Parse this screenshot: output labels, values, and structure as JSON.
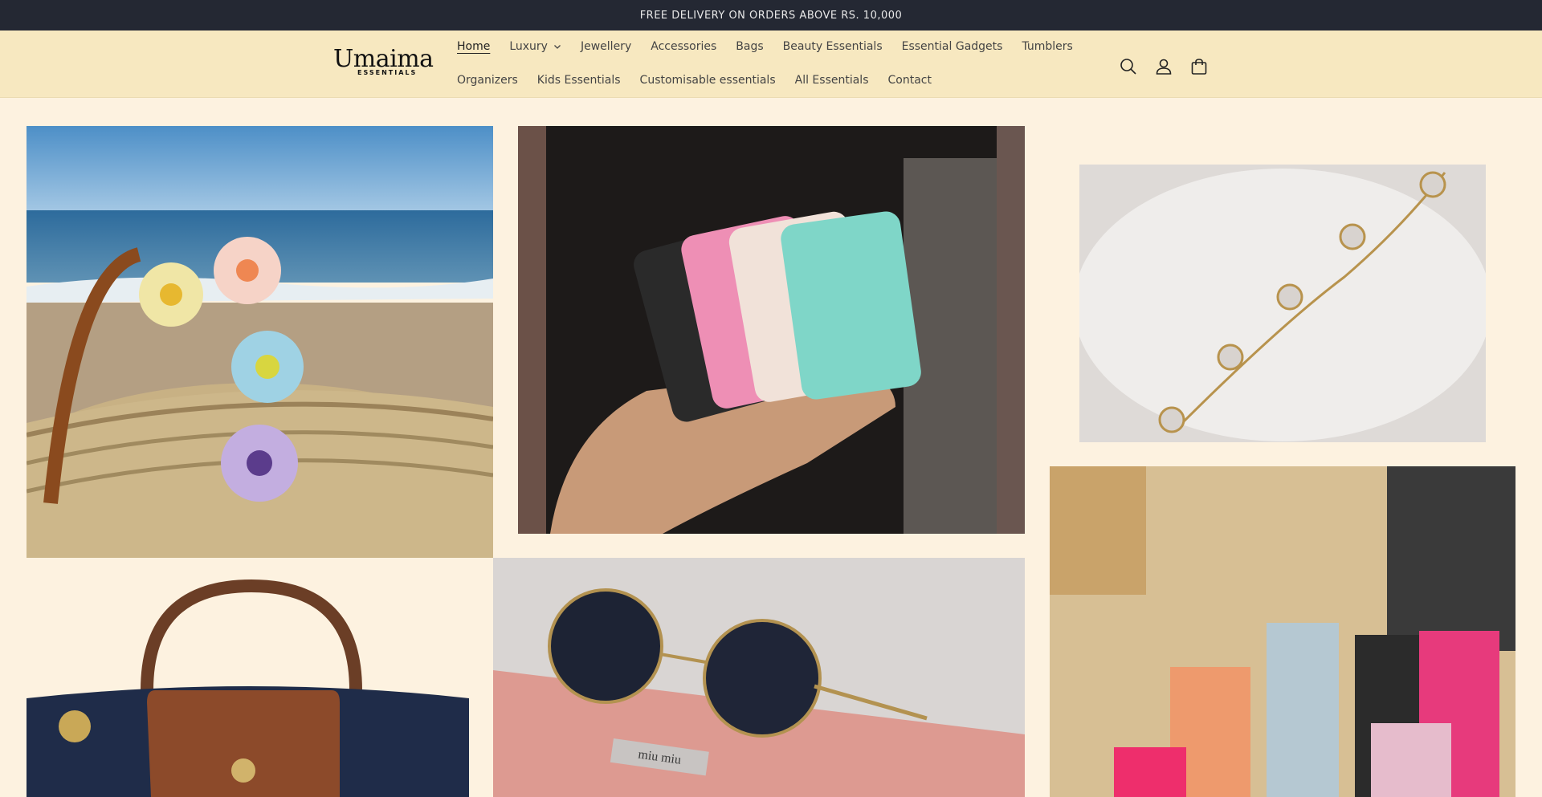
{
  "announcement": {
    "text": "FREE DELIVERY ON ORDERS ABOVE RS. 10,000"
  },
  "brand": {
    "name": "Umaima",
    "subtitle": "ESSENTIALS"
  },
  "nav": {
    "row1": [
      {
        "label": "Home",
        "active": true
      },
      {
        "label": "Luxury",
        "has_dropdown": true
      },
      {
        "label": "Jewellery"
      },
      {
        "label": "Accessories"
      },
      {
        "label": "Bags"
      },
      {
        "label": "Beauty Essentials"
      },
      {
        "label": "Essential Gadgets"
      },
      {
        "label": "Tumblers"
      }
    ],
    "row2": [
      {
        "label": "Organizers"
      },
      {
        "label": "Kids Essentials"
      },
      {
        "label": "Customisable essentials"
      },
      {
        "label": "All Essentials"
      },
      {
        "label": "Contact"
      }
    ]
  },
  "header_icons": [
    "search-icon",
    "account-icon",
    "cart-icon"
  ],
  "gallery": {
    "images": [
      "flower-claw-clips-on-beach-basket",
      "phone-suction-pads-in-hand",
      "clover-chain-bracelet-on-plate",
      "navy-tote-bag-brown-leather-flap",
      "round-sunglasses-on-pink-case",
      "colorful-tumblers-on-shelf"
    ],
    "case_text": "miu miu"
  },
  "colors": {
    "announcement_bg": "#242833",
    "header_bg": "#f7e8c0",
    "page_bg": "#fdf2e0"
  }
}
